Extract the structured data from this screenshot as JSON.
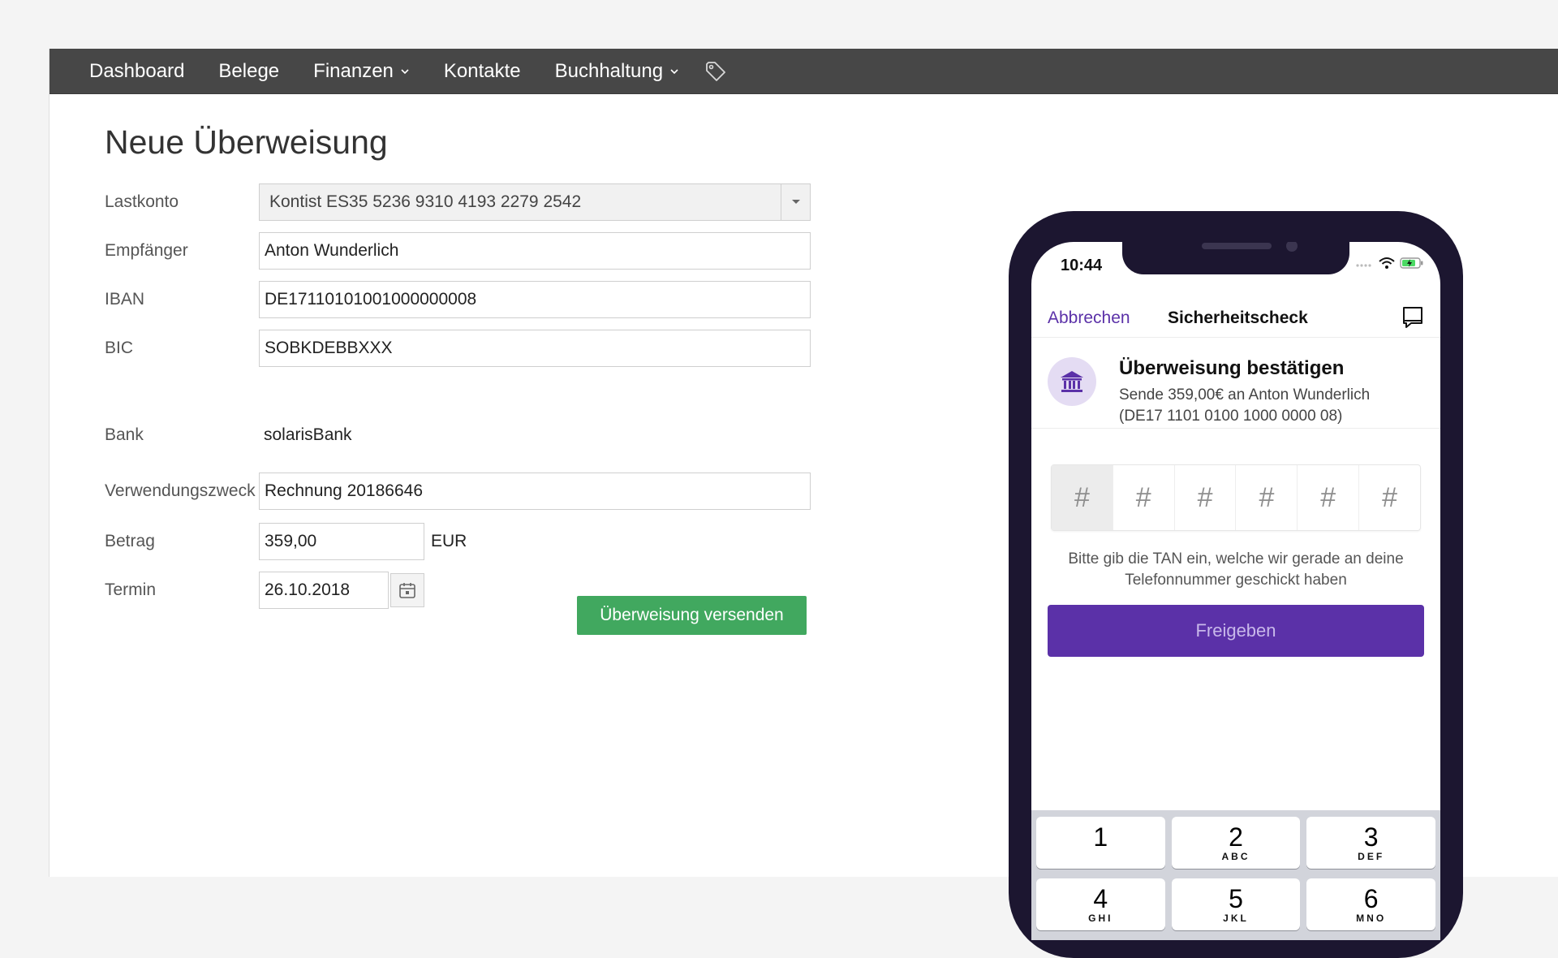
{
  "nav": {
    "items": [
      {
        "label": "Dashboard"
      },
      {
        "label": "Belege"
      },
      {
        "label": "Finanzen"
      },
      {
        "label": "Kontakte"
      },
      {
        "label": "Buchhaltung"
      }
    ]
  },
  "form": {
    "title": "Neue Überweisung",
    "account": {
      "label": "Lastkonto",
      "value": "Kontist ES35 5236 9310 4193 2279 2542"
    },
    "recipient": {
      "label": "Empfänger",
      "value": "Anton Wunderlich"
    },
    "iban": {
      "label": "IBAN",
      "value": "DE17110101001000000008"
    },
    "bic": {
      "label": "BIC",
      "value": "SOBKDEBBXXX"
    },
    "bank": {
      "label": "Bank",
      "value": "solarisBank"
    },
    "purpose": {
      "label": "Verwendungszweck",
      "value": "Rechnung 20186646"
    },
    "amount": {
      "label": "Betrag",
      "value": "359,00",
      "currency": "EUR"
    },
    "date": {
      "label": "Termin",
      "value": "26.10.2018"
    },
    "submit_label": "Überweisung versenden"
  },
  "phone": {
    "time": "10:44",
    "header": {
      "cancel": "Abbrechen",
      "title": "Sicherheitscheck"
    },
    "card": {
      "title": "Überweisung bestätigen",
      "line1": "Sende 359,00€ an Anton Wunderlich",
      "line2": "(DE17 1101 0100 1000 0000 08)"
    },
    "tan_cells": [
      "#",
      "#",
      "#",
      "#",
      "#",
      "#"
    ],
    "hint_line1": "Bitte gib die TAN ein, welche wir gerade an deine",
    "hint_line2": "Telefonnummer geschickt haben",
    "release_label": "Freigeben",
    "keypad": [
      {
        "num": "1",
        "letters": ""
      },
      {
        "num": "2",
        "letters": "ABC"
      },
      {
        "num": "3",
        "letters": "DEF"
      },
      {
        "num": "4",
        "letters": "GHI"
      },
      {
        "num": "5",
        "letters": "JKL"
      },
      {
        "num": "6",
        "letters": "MNO"
      }
    ]
  },
  "colors": {
    "navbar": "#474747",
    "submit_green": "#41a85f",
    "accent_purple": "#5b31a8",
    "phone_frame": "#1c1630"
  },
  "icons": [
    "chevron-down-icon",
    "tag-icon",
    "dropdown-arrow-icon",
    "calendar-icon",
    "wifi-icon",
    "battery-icon",
    "chat-icon",
    "bank-icon"
  ]
}
